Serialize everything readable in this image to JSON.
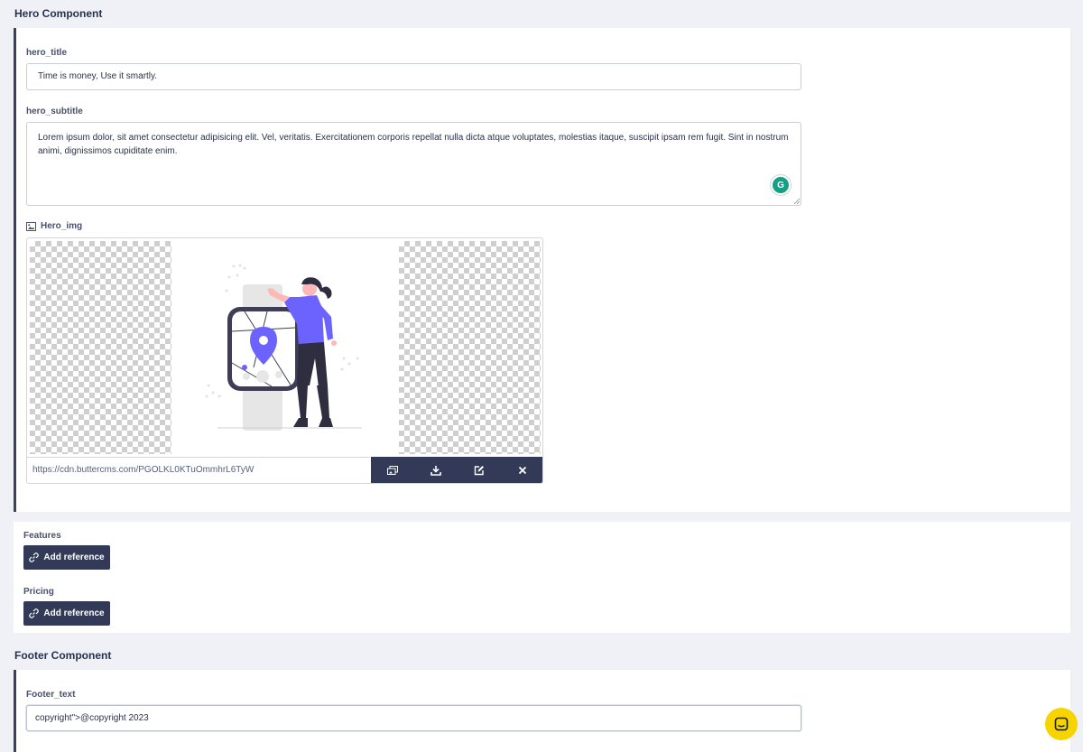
{
  "hero": {
    "section_title": "Hero Component",
    "title_label": "hero_title",
    "title_value": "Time is money,  Use it smartly.",
    "subtitle_label": "hero_subtitle",
    "subtitle_value": "Lorem ipsum dolor, sit amet consectetur adipisicing elit. Vel, veritatis. Exercitationem corporis repellat nulla dicta atque voluptates, molestias itaque, suscipit ipsam rem fugit. Sint in nostrum animi, dignissimos cupiditate enim.",
    "img_label": "Hero_img",
    "img_url": "https://cdn.buttercms.com/PGOLKL0KTuOmmhrL6TyW",
    "toolbar": [
      "media-library-icon",
      "download-icon",
      "edit-icon",
      "close-icon"
    ]
  },
  "references": {
    "features_label": "Features",
    "pricing_label": "Pricing",
    "add_reference_label": "Add reference"
  },
  "footer": {
    "section_title": "Footer Component",
    "text_label": "Footer_text",
    "text_value": "copyright\">@copyright 2023"
  },
  "colors": {
    "background": "#eff1f6",
    "dark_button": "#323a57",
    "accent_purple": "#6c63ff",
    "grammarly_green": "#15a085",
    "chat_yellow": "#f5d400"
  }
}
